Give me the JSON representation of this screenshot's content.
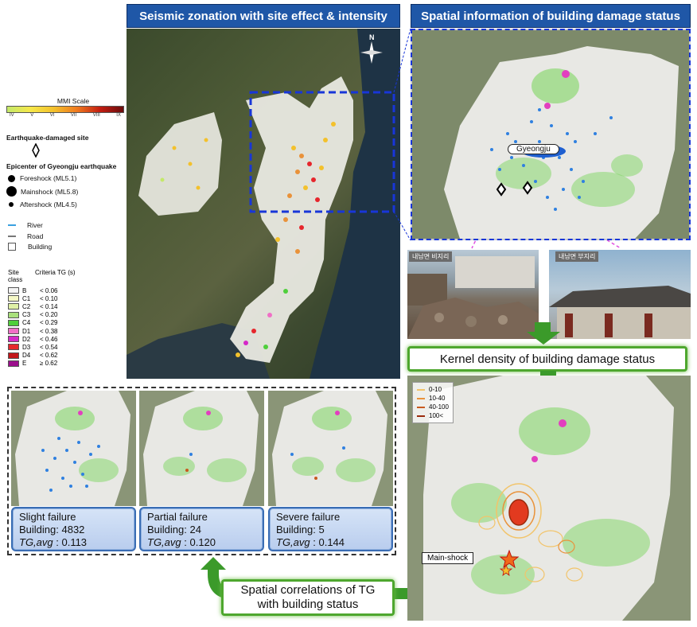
{
  "headers": {
    "left": "Seismic zonation with site effect & intensity",
    "right": "Spatial information  of building damage status"
  },
  "legend": {
    "mmi_title": "MMI Scale",
    "mmi_ticks": [
      "IV",
      "V",
      "VI",
      "VII",
      "VIII",
      "IX"
    ],
    "damaged_site": "Earthquake-damaged site",
    "epicenter_title": "Epicenter of Gyeongju earthquake",
    "foreshock": "Foreshock (ML5.1)",
    "mainshock": "Mainshock (ML5.8)",
    "aftershock": "Aftershock (ML4.5)",
    "river": "River",
    "road": "Road",
    "building": "Building",
    "site_class_hdr": "Site class",
    "criteria_hdr": "Criteria TG (s)",
    "site_classes": [
      {
        "c": "B",
        "v": "< 0.06",
        "color": "#f4f4f4"
      },
      {
        "c": "C1",
        "v": "< 0.10",
        "color": "#f4f7c6"
      },
      {
        "c": "C2",
        "v": "< 0.14",
        "color": "#dff0a6"
      },
      {
        "c": "C3",
        "v": "< 0.20",
        "color": "#a9e07c"
      },
      {
        "c": "C4",
        "v": "< 0.29",
        "color": "#4fcf3b"
      },
      {
        "c": "D1",
        "v": "< 0.38",
        "color": "#f06fc6"
      },
      {
        "c": "D2",
        "v": "< 0.46",
        "color": "#d528c8"
      },
      {
        "c": "D3",
        "v": "< 0.54",
        "color": "#e6262c"
      },
      {
        "c": "D4",
        "v": "< 0.62",
        "color": "#c2161a"
      },
      {
        "c": "E",
        "v": "≥ 0.62",
        "color": "#9c0f8d"
      }
    ],
    "colors": {
      "mmi_low": "#c4e96a",
      "mmi_mid": "#f3c12c",
      "mmi_high": "#c21d11",
      "mmi_top": "#6b0d0d"
    }
  },
  "right_map": {
    "label": "Gyeongju"
  },
  "photos": {
    "left_caption": "내남면 비지리",
    "right_caption": "내남면 부지리"
  },
  "kernel": {
    "title": "Kernel density of building damage status",
    "legend": [
      {
        "label": "0-10",
        "color": "#f2c46a"
      },
      {
        "label": "10-40",
        "color": "#e9923a"
      },
      {
        "label": "40-100",
        "color": "#c85a1e"
      },
      {
        "label": "100<",
        "color": "#9a2a0c"
      }
    ],
    "mainshock_label": "Main-shock"
  },
  "panels": [
    {
      "title": "Slight failure",
      "building": "Building: 4832",
      "tg_label": "TG,avg",
      "tg_value": ": 0.113"
    },
    {
      "title": "Partial failure",
      "building": "Building: 24",
      "tg_label": "TG,avg",
      "tg_value": ": 0.120"
    },
    {
      "title": "Severe failure",
      "building": "Building: 5",
      "tg_label": "TG,avg",
      "tg_value": ": 0.144"
    }
  ],
  "correlation": {
    "line1": "Spatial correlations of TG",
    "line2": "with building status"
  },
  "compass": {
    "north": "N"
  }
}
